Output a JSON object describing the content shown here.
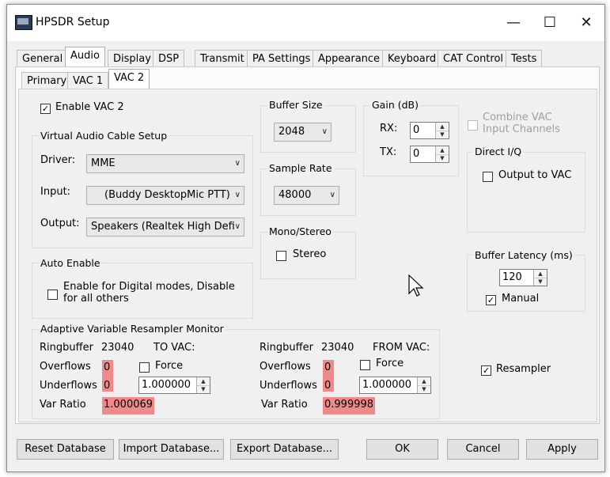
{
  "window": {
    "title": "HPSDR Setup",
    "minimize": "—",
    "maximize": "☐",
    "close": "✕"
  },
  "tabs": [
    "General",
    "Audio",
    "Display",
    "DSP",
    "Transmit",
    "PA Settings",
    "Appearance",
    "Keyboard",
    "CAT Control",
    "Tests"
  ],
  "subtabs": [
    "Primary",
    "VAC 1",
    "VAC 2"
  ],
  "enable_vac2": {
    "label": "Enable VAC 2",
    "checked": true
  },
  "vac_setup": {
    "title": "Virtual Audio Cable Setup",
    "driver_label": "Driver:",
    "driver_value": "MME",
    "input_label": "Input:",
    "input_value": "(Buddy DesktopMic PTT)",
    "output_label": "Output:",
    "output_value": "Speakers (Realtek High Defi"
  },
  "buffer_size": {
    "title": "Buffer Size",
    "value": "2048"
  },
  "sample_rate": {
    "title": "Sample Rate",
    "value": "48000"
  },
  "mono_stereo": {
    "title": "Mono/Stereo",
    "stereo_label": "Stereo"
  },
  "gain": {
    "title": "Gain (dB)",
    "rx_label": "RX:",
    "rx_value": "0",
    "tx_label": "TX:",
    "tx_value": "0"
  },
  "combine_vac": {
    "line1": "Combine VAC",
    "line2": "Input Channels"
  },
  "direct_iq": {
    "title": "Direct I/Q",
    "output_label": "Output to VAC"
  },
  "auto_enable": {
    "title": "Auto Enable",
    "line1": "Enable for Digital modes, Disable",
    "line2": "for all others"
  },
  "buffer_latency": {
    "title": "Buffer Latency (ms)",
    "value": "120",
    "manual_label": "Manual"
  },
  "resampler": {
    "label": "Resampler"
  },
  "avr": {
    "title": "Adaptive Variable Resampler Monitor",
    "to": {
      "ringbuffer_label": "Ringbuffer",
      "ringbuffer_value": "23040",
      "direction": "TO VAC:",
      "overflows_label": "Overflows",
      "overflows_value": "0",
      "force_label": "Force",
      "underflows_label": "Underflows",
      "underflows_value": "0",
      "force_value": "1.000000",
      "varratio_label": "Var Ratio",
      "varratio_value": "1.000069"
    },
    "from": {
      "ringbuffer_label": "Ringbuffer",
      "ringbuffer_value": "23040",
      "direction": "FROM VAC:",
      "overflows_label": "Overflows",
      "overflows_value": "0",
      "force_label": "Force",
      "underflows_label": "Underflows",
      "underflows_value": "0",
      "force_value": "1.000000",
      "varratio_label": "Var Ratio",
      "varratio_value": "0.999998"
    }
  },
  "buttons": {
    "reset": "Reset Database",
    "import": "Import Database...",
    "export": "Export Database...",
    "ok": "OK",
    "cancel": "Cancel",
    "apply": "Apply"
  },
  "icons": {
    "check": "✓",
    "arrow_down": "∨",
    "spin_up": "▲",
    "spin_down": "▼"
  }
}
